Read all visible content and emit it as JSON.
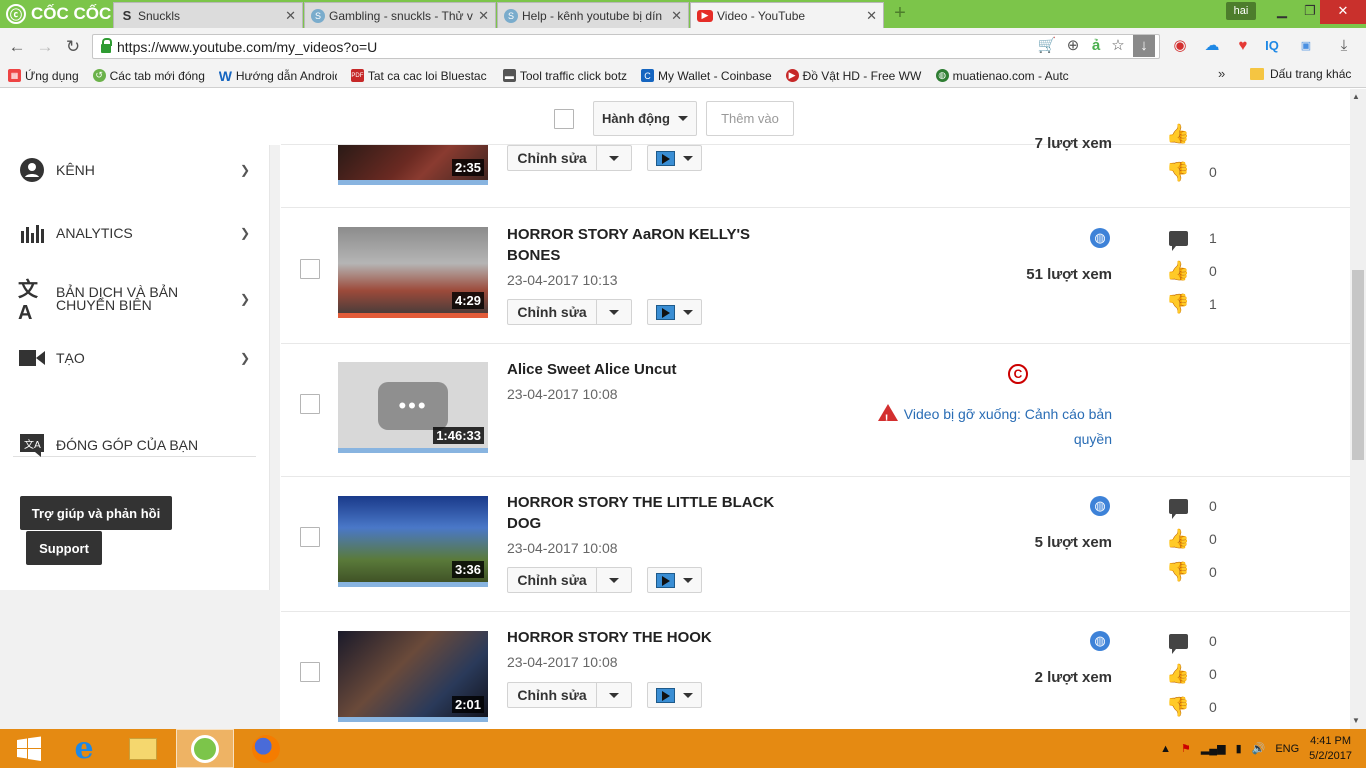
{
  "browser": {
    "logo": "CỐC CỐC",
    "tabs": [
      {
        "label": "Snuckls",
        "icon": "s-icon"
      },
      {
        "label": "Gambling - snuckls - Thử v",
        "icon": "s-icon"
      },
      {
        "label": "Help - kênh youtube bị dín",
        "icon": "s-icon"
      },
      {
        "label": "Video - YouTube",
        "icon": "youtube-icon"
      }
    ],
    "user": "hai",
    "url": "https://www.youtube.com/my_videos?o=U",
    "bookmarks": [
      "Ứng dụng",
      "Các tab mới đóng",
      "Hướng dẫn Android.cl",
      "Tat ca cac loi Bluestac",
      "Tool traffic click botz",
      "My Wallet - Coinbase",
      "Đồ Vật HD - Free WW",
      "muatienao.com - Autc"
    ],
    "other_bookmarks": "Dấu trang khác",
    "more": "»"
  },
  "sidebar": {
    "items": [
      {
        "label": "KÊNH"
      },
      {
        "label": "ANALYTICS"
      },
      {
        "label": "BẢN DỊCH VÀ BẢN CHUYỂN BIÊN"
      },
      {
        "label": "TẠO"
      }
    ],
    "contrib": "ĐÓNG GÓP CỦA BẠN",
    "help": "Trợ giúp và phản hồi",
    "support": "Support"
  },
  "actions": {
    "action": "Hành động",
    "add": "Thêm vào"
  },
  "videos": [
    {
      "duration": "2:35",
      "edit": "Chỉnh sửa",
      "views": "7 lượt xem",
      "dislikes": "0"
    },
    {
      "title": "HORROR STORY AaRON KELLY'S BONES",
      "date": "23-04-2017 10:13",
      "duration": "4:29",
      "edit": "Chỉnh sửa",
      "views": "51 lượt xem",
      "comments": "1",
      "likes": "0",
      "dislikes": "1"
    },
    {
      "title": "Alice Sweet Alice Uncut",
      "date": "23-04-2017 10:08",
      "duration": "1:46:33",
      "warning": "Video bị gỡ xuống: Cảnh cáo bản quyền"
    },
    {
      "title": "HORROR STORY THE LITTLE BLACK DOG",
      "date": "23-04-2017 10:08",
      "duration": "3:36",
      "edit": "Chỉnh sửa",
      "views": "5 lượt xem",
      "comments": "0",
      "likes": "0",
      "dislikes": "0"
    },
    {
      "title": "HORROR STORY THE HOOK",
      "date": "23-04-2017 10:08",
      "duration": "2:01",
      "edit": "Chỉnh sửa",
      "views": "2 lượt xem",
      "comments": "0",
      "likes": "0",
      "dislikes": "0"
    }
  ],
  "taskbar": {
    "lang": "ENG",
    "time": "4:41 PM",
    "date": "5/2/2017"
  },
  "colors": {
    "brand": "#7cc54a",
    "taskbar": "#e58a12",
    "link": "#2a6db5",
    "warning": "#d32f2f"
  }
}
